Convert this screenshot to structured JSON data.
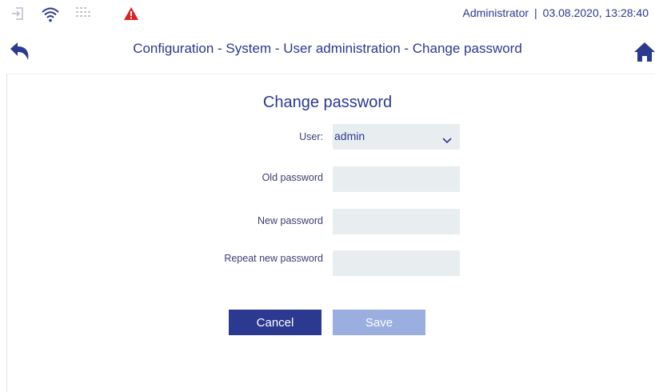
{
  "statusbar": {
    "user": "Administrator",
    "separator": "|",
    "datetime": "03.08.2020, 13:28:40",
    "icons": [
      "login-icon",
      "wifi-icon",
      "network-grid-icon",
      "warning-icon"
    ],
    "colors": {
      "accent": "#2b3990",
      "warning": "#e02020",
      "muted": "#b9bcc6"
    }
  },
  "nav": {
    "breadcrumb": "Configuration - System - User administration - Change password",
    "back_icon": "back-arrow-icon",
    "home_icon": "home-icon"
  },
  "form": {
    "title": "Change password",
    "user_label": "User:",
    "user_value": "admin",
    "old_password_label": "Old password",
    "new_password_label": "New password",
    "repeat_password_label": "Repeat new password",
    "old_password_value": "",
    "new_password_value": "",
    "repeat_password_value": ""
  },
  "buttons": {
    "cancel": "Cancel",
    "save": "Save",
    "save_enabled": false
  },
  "colors": {
    "primary": "#2b3990",
    "disabled": "#9aaee0",
    "field_bg": "#e8eef0"
  }
}
